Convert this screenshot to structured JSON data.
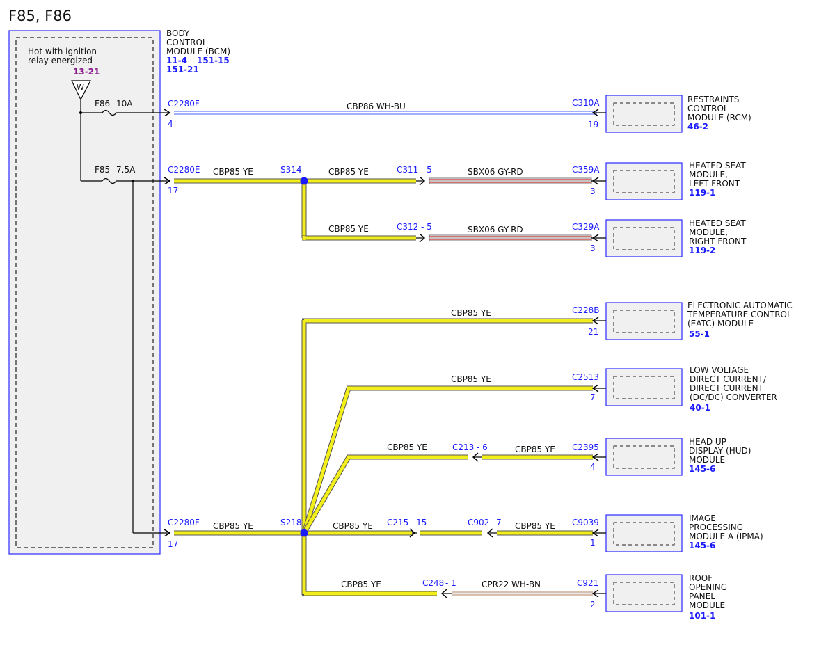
{
  "page_title": "F85, F86",
  "power_source": {
    "desc_line1": "Hot with ignition",
    "desc_line2": "relay energized",
    "ref": "13-21",
    "symbol": "W"
  },
  "bcm": {
    "name_lines": [
      "BODY",
      "CONTROL",
      "MODULE (BCM)"
    ],
    "ref_a": "11-4",
    "ref_b": "151-15",
    "ref_c": "151-21"
  },
  "fuses": [
    {
      "name": "F86",
      "rating": "10A"
    },
    {
      "name": "F85",
      "rating": "7.5A"
    }
  ],
  "connectors": {
    "bcm_f86": {
      "id": "C2280F",
      "pin": "4"
    },
    "bcm_f85_top": {
      "id": "C2280E",
      "pin": "17"
    },
    "bcm_f85_bottom": {
      "id": "C2280F",
      "pin": "17"
    },
    "c311": "C311",
    "c311_pin": "- 5",
    "c312": "C312",
    "c312_pin": "- 5",
    "c213": "C213",
    "c213_pin": "- 6",
    "c215": "C215",
    "c215_pin": "- 15",
    "c902": "C902",
    "c902_pin": "- 7",
    "c248": "C248",
    "c248_pin": "- 1"
  },
  "splices": {
    "s314": "S314",
    "s218": "S218"
  },
  "wires": {
    "cbp86": "CBP86  WH-BU",
    "cbp85": "CBP85  YE",
    "sbx06": "SBX06  GY-RD",
    "cpr22": "CPR22  WH-BN"
  },
  "modules": [
    {
      "connector": "C310A",
      "pin": "19",
      "name_lines": [
        "RESTRAINTS",
        "CONTROL",
        "MODULE (RCM)"
      ],
      "ref": "46-2"
    },
    {
      "connector": "C359A",
      "pin": "3",
      "name_lines": [
        "HEATED SEAT",
        "MODULE,",
        "LEFT FRONT"
      ],
      "ref": "119-1"
    },
    {
      "connector": "C329A",
      "pin": "3",
      "name_lines": [
        "HEATED SEAT",
        "MODULE,",
        "RIGHT FRONT"
      ],
      "ref": "119-2"
    },
    {
      "connector": "C228B",
      "pin": "21",
      "name_lines": [
        "ELECTRONIC AUTOMATIC",
        "TEMPERATURE CONTROL",
        "(EATC) MODULE"
      ],
      "ref": "55-1"
    },
    {
      "connector": "C2513",
      "pin": "7",
      "name_lines": [
        "LOW VOLTAGE",
        "DIRECT CURRENT/",
        "DIRECT CURRENT",
        "(DC/DC) CONVERTER"
      ],
      "ref": "40-1"
    },
    {
      "connector": "C2395",
      "pin": "4",
      "name_lines": [
        "HEAD UP",
        "DISPLAY (HUD)",
        "MODULE"
      ],
      "ref": "145-6"
    },
    {
      "connector": "C9039",
      "pin": "1",
      "name_lines": [
        "IMAGE",
        "PROCESSING",
        "MODULE A (IPMA)"
      ],
      "ref": "145-6"
    },
    {
      "connector": "C921",
      "pin": "2",
      "name_lines": [
        "ROOF",
        "OPENING",
        "PANEL",
        "MODULE"
      ],
      "ref": "101-1"
    }
  ],
  "colors": {
    "yellow_wire": "#f2ee1a",
    "module_border": "#2a2aff",
    "module_fill": "#f0f0f0",
    "connector_text": "#1a1aff",
    "ref_purple": "#8a1a8a"
  }
}
